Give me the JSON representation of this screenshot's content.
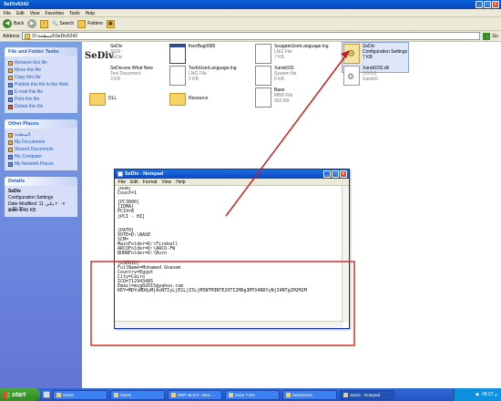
{
  "window": {
    "title": "SeDiv5242"
  },
  "menubar": [
    "File",
    "Edit",
    "View",
    "Favorites",
    "Tools",
    "Help"
  ],
  "toolbar": {
    "back": "Back",
    "search": "Search",
    "folders": "Folders"
  },
  "address": {
    "label": "Address",
    "value": "D:\\السطحة\\SeDiv5242",
    "go": "Go"
  },
  "sidebar": {
    "file_tasks": {
      "title": "File and Folder Tasks",
      "items": [
        "Rename this file",
        "Move this file",
        "Copy this file",
        "Publish this file to the Web",
        "E-mail this file",
        "Print this file",
        "Delete this file"
      ]
    },
    "other_places": {
      "title": "Other Places",
      "items": [
        "السطحة",
        "My Documents",
        "Shared Documents",
        "My Computer",
        "My Network Places"
      ]
    },
    "details": {
      "title": "Details",
      "name": "SeDiv",
      "type": "Configuration Settings",
      "modified": "Date Modified: 11 ٢٠٠٧ ينایر, 01:25 م",
      "size": "Size: 6.46 KB"
    }
  },
  "content": {
    "logo_text": "SeDiv",
    "files": [
      {
        "name": "SeDiv",
        "sub1": "SEDi",
        "sub2": "SeDiv",
        "icon": "window-icon"
      },
      {
        "name": "fixerBug0085",
        "sub1": "",
        "sub2": "",
        "icon": "window-icon"
      },
      {
        "name": "SeagateUserLanguage.lng",
        "sub1": "LNG File",
        "sub2": "7 KB",
        "icon": "file-icon"
      },
      {
        "name": "SeDiv",
        "sub1": "Configuration Settings",
        "sub2": "7 KB",
        "icon": "config-icon"
      },
      {
        "name": "SeDiv.exe What New",
        "sub1": "Text Document",
        "sub2": "3 KB",
        "icon": "text-icon"
      },
      {
        "name": "ToshiUserLanguage.lng",
        "sub1": "LNG File",
        "sub2": "2 KB",
        "icon": "file-icon"
      },
      {
        "name": "Xandr032",
        "sub1": "System file",
        "sub2": "6 KB",
        "icon": "file-icon"
      },
      {
        "name": "XandrD32.dll",
        "sub1": "3.0.0.0",
        "sub2": "XandrD",
        "icon": "dll-icon"
      },
      {
        "name": "Base",
        "sub1": "MBB File",
        "sub2": "952 KB",
        "icon": "file-icon"
      },
      {
        "name": "DLL",
        "sub1": "",
        "sub2": "",
        "icon": "folder-icon"
      },
      {
        "name": "Resource",
        "sub1": "",
        "sub2": "",
        "icon": "folder-icon"
      }
    ]
  },
  "notepad": {
    "title": "SeDiv - Notepad",
    "menu": [
      "File",
      "Edit",
      "Format",
      "View",
      "Help"
    ],
    "text": "[RUN]\nCount=1\n\n[PC3000]\n[IDMA]\nPCIX=8\n[PCI - HZ]\n\n\n[PATH]\nVOTE=D:\\BASE\nSCM=\nMainFolder=D:\\Fireball\nARCOFolder=D:\\ARCO-FW\nBURNFolder=D:\\Burn\n\n[USERID]\nFullName=Mohamed Ghanem\nCountry=Egypt\nCity=Cairo\nICQ=712943485\nEmail=msg02015@yahoo.com\nKEY=MDYuMDQuMjAxNTIyLjE1LjI5LjM5NTM3NTE2OTI2MDg3MTU4NDYyNjI4NTg2M2M2M"
  },
  "taskbar": {
    "start": "start",
    "tasks": [
      "SeDiv",
      "SeDiv",
      "SMT v6.0.9 - New ...",
      "Scan 7.9%",
      "SeDiv5242",
      "SeDiv - Notepad"
    ],
    "clock": "08:22 م"
  },
  "annotation": {
    "box_color": "#d03030",
    "arrow_color": "#c82020"
  }
}
